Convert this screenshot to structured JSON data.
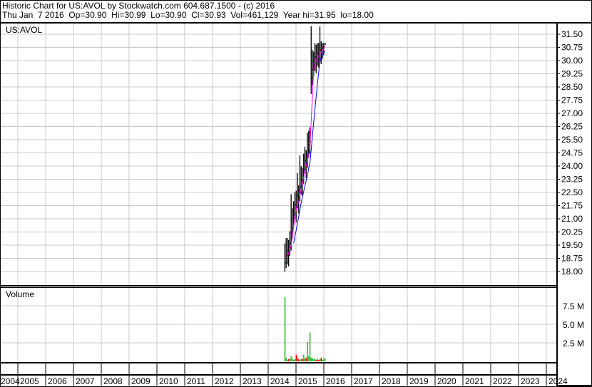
{
  "header": {
    "line1": "Historic Chart for US:AVOL by Stockwatch.com 604.687.1500 - (c) 2016",
    "line2": "Thu Jan  7 2016  Op=30.90  Hi=30.99  Lo=30.90  Cl=30.93  Vol=461,129  Year hi=31.95  lo=18.00"
  },
  "chart_data": [
    {
      "type": "line",
      "title": "US:AVOL",
      "series_kind": "ohlc-bars with moving averages",
      "ylim": [
        18.0,
        31.5
      ],
      "yticks": [
        "31.50",
        "30.75",
        "30.00",
        "29.25",
        "28.50",
        "27.75",
        "27.00",
        "26.25",
        "25.50",
        "24.75",
        "24.00",
        "23.25",
        "22.50",
        "21.75",
        "21.00",
        "20.25",
        "19.50",
        "18.75",
        "18.00"
      ],
      "x_start": 2014.6,
      "x_step": 0.045,
      "close": [
        18.5,
        18.9,
        19.2,
        19.0,
        19.6,
        19.9,
        20.5,
        21.2,
        21.8,
        21.5,
        22.3,
        22.0,
        22.8,
        23.2,
        23.0,
        23.8,
        24.3,
        24.0,
        24.6,
        25.2,
        25.4,
        29.0,
        29.5,
        29.8,
        30.2,
        30.0,
        30.4,
        30.3,
        30.6,
        30.5,
        30.7,
        30.8,
        30.93
      ],
      "high": [
        19.6,
        19.9,
        19.9,
        19.8,
        20.3,
        22.4,
        21.6,
        22.0,
        22.5,
        22.6,
        23.6,
        22.9,
        24.6,
        24.0,
        23.9,
        24.7,
        25.1,
        24.9,
        25.9,
        26.0,
        26.2,
        31.95,
        30.6,
        30.5,
        31.0,
        30.9,
        31.0,
        31.0,
        31.95,
        31.1,
        31.0,
        31.0,
        30.99
      ],
      "low": [
        18.0,
        18.2,
        18.4,
        18.3,
        18.9,
        19.2,
        19.9,
        20.6,
        21.0,
        20.8,
        21.6,
        21.3,
        22.0,
        22.4,
        22.3,
        23.0,
        23.6,
        23.3,
        23.9,
        24.5,
        24.7,
        28.1,
        28.6,
        29.1,
        29.4,
        29.3,
        29.7,
        29.6,
        29.9,
        29.8,
        30.1,
        30.3,
        30.9
      ],
      "ma_colors": [
        "#ff00ff",
        "#0000ff"
      ],
      "ma_periods": [
        3,
        8
      ],
      "up_color": "#000000",
      "down_color": "#ff0000"
    },
    {
      "type": "bar",
      "title": "Volume",
      "ylim": [
        0,
        9.5
      ],
      "yticks": [
        "7.5 M",
        "5.0 M",
        "2.5 M"
      ],
      "ytick_values": [
        7.5,
        5.0,
        2.5
      ],
      "values_millions": [
        8.7,
        0.5,
        0.2,
        0.3,
        0.4,
        0.7,
        0.3,
        0.2,
        0.3,
        0.9,
        0.6,
        0.3,
        0.2,
        0.4,
        0.3,
        0.9,
        0.4,
        0.5,
        2.6,
        0.7,
        3.9,
        0.5,
        0.4,
        0.3,
        0.3,
        0.2,
        0.4,
        0.2,
        0.3,
        0.5,
        0.2,
        0.3,
        0.46
      ],
      "bar_colors": [
        "#33bb33",
        "#ff0000"
      ]
    }
  ],
  "x_axis": {
    "years": [
      "2004",
      "2005",
      "2006",
      "2007",
      "2008",
      "2009",
      "2010",
      "2011",
      "2012",
      "2013",
      "2014",
      "2015",
      "2016",
      "2017",
      "2018",
      "2019",
      "2020",
      "2021",
      "2022",
      "2023",
      "2024"
    ]
  }
}
